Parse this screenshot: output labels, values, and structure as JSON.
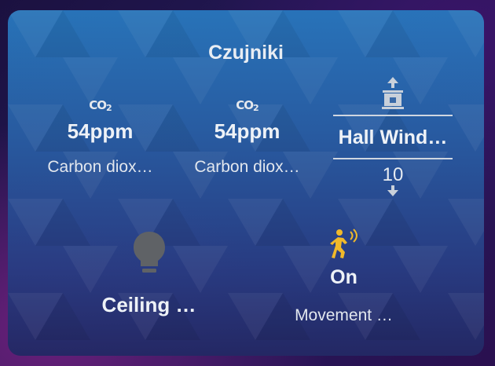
{
  "card": {
    "title": "Czujniki"
  },
  "sensors": [
    {
      "icon": "co2-icon",
      "value": "54ppm",
      "label": "Carbon diox…"
    },
    {
      "icon": "co2-icon",
      "value": "54ppm",
      "label": "Carbon diox…"
    }
  ],
  "window_cover": {
    "name": "Hall Wind…",
    "position": "10",
    "icons": [
      "arrow-up-icon",
      "window-cover-icon",
      "arrow-down-icon"
    ]
  },
  "light": {
    "icon": "lightbulb-icon",
    "name": "Ceiling …"
  },
  "motion": {
    "icon": "motion-sensor-icon",
    "state": "On",
    "name": "Movement …",
    "active_color": "#f0b92a"
  },
  "colors": {
    "text": "#eef2f7",
    "icon_grey": "#5f6266",
    "accent_yellow": "#f0b92a"
  }
}
